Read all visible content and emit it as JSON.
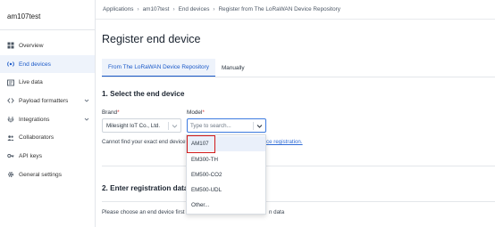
{
  "app": {
    "title": "am107test"
  },
  "sidebar": {
    "items": [
      {
        "label": "Overview",
        "icon": "overview-icon"
      },
      {
        "label": "End devices",
        "icon": "end-devices-icon",
        "active": true
      },
      {
        "label": "Live data",
        "icon": "live-data-icon"
      },
      {
        "label": "Payload formatters",
        "icon": "payload-formatters-icon",
        "expandable": true
      },
      {
        "label": "Integrations",
        "icon": "integrations-icon",
        "expandable": true
      },
      {
        "label": "Collaborators",
        "icon": "collaborators-icon"
      },
      {
        "label": "API keys",
        "icon": "api-keys-icon"
      },
      {
        "label": "General settings",
        "icon": "gear-icon"
      }
    ]
  },
  "breadcrumb": [
    "Applications",
    "am107test",
    "End devices",
    "Register from The LoRaWAN Device Repository"
  ],
  "page": {
    "title": "Register end device"
  },
  "tabs": [
    {
      "label": "From The LoRaWAN Device Repository",
      "active": true
    },
    {
      "label": "Manually",
      "active": false
    }
  ],
  "section1": {
    "title": "1. Select the end device"
  },
  "brand": {
    "label": "Brand",
    "required_mark": "*",
    "value": "Milesight IoT Co., Ltd."
  },
  "model": {
    "label": "Model",
    "required_mark": "*",
    "placeholder": "Type to search..."
  },
  "hint": {
    "text": "Cannot find your exact end device?",
    "link": "ce registration."
  },
  "model_options": [
    "AM107",
    "EM300-TH",
    "EM500-CO2",
    "EM500-UDL",
    "Other..."
  ],
  "highlighted_option": "AM107",
  "section2": {
    "title": "2. Enter registration data"
  },
  "bottom": {
    "text_left": "Please choose an end device first to",
    "text_right": "n data"
  },
  "colors": {
    "accent": "#1a59c8",
    "highlight_box": "#d11a1a"
  }
}
